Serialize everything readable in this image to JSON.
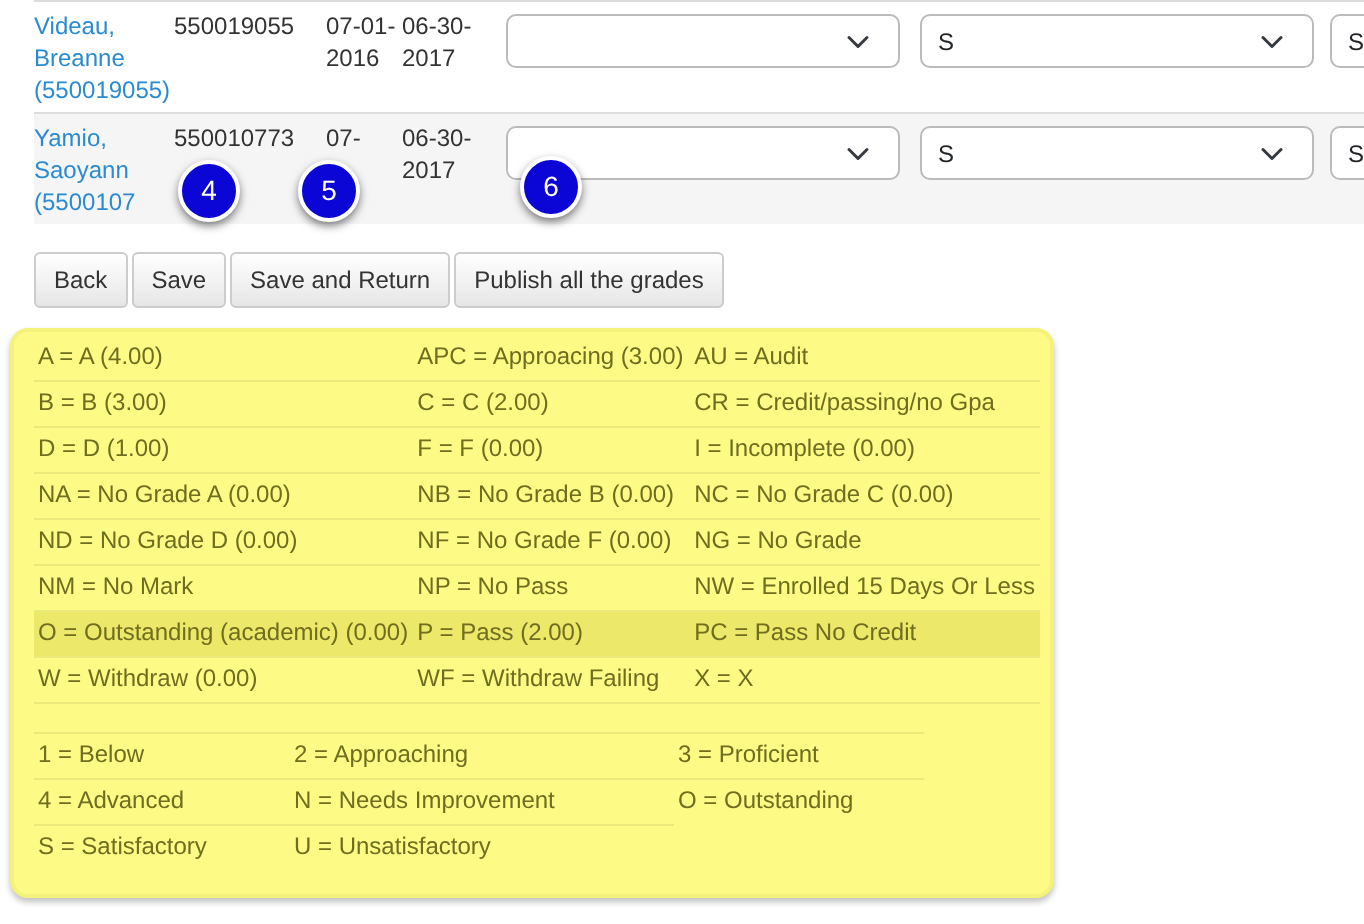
{
  "students": [
    {
      "name": "Videau, Breanne (550019055)",
      "id": "550019055",
      "start_date": "07-01-2016",
      "end_date": "06-30-2017",
      "selects": [
        {
          "kind": "select"
        },
        {
          "kind": "select",
          "value": "S"
        },
        {
          "kind": "select",
          "value": "S"
        }
      ]
    },
    {
      "name": "Yamio, Saoyann (5500107",
      "id": "550010773",
      "start_date": "07-",
      "end_date": "06-30-2017",
      "selects": [
        {
          "kind": "select"
        },
        {
          "kind": "select",
          "value": "S"
        },
        {
          "kind": "select",
          "value": "S"
        }
      ]
    }
  ],
  "callouts": [
    "4",
    "5",
    "6"
  ],
  "buttons": [
    "Back",
    "Save",
    "Save and Return",
    "Publish all the grades"
  ],
  "grade_codes": [
    {
      "cells": [
        "A = A (4.00)",
        "APC = Approacing (3.00)",
        "AU = Audit"
      ],
      "highlighted": false
    },
    {
      "cells": [
        "B = B (3.00)",
        "C = C (2.00)",
        "CR = Credit/passing/no Gpa"
      ],
      "highlighted": false
    },
    {
      "cells": [
        "D = D (1.00)",
        "F = F (0.00)",
        "I = Incomplete (0.00)"
      ],
      "highlighted": false
    },
    {
      "cells": [
        "NA = No Grade A (0.00)",
        "NB = No Grade B (0.00)",
        "NC = No Grade C (0.00)"
      ],
      "highlighted": false
    },
    {
      "cells": [
        "ND = No Grade D (0.00)",
        "NF = No Grade F (0.00)",
        "NG = No Grade"
      ],
      "highlighted": false
    },
    {
      "cells": [
        "NM = No Mark",
        "NP = No Pass",
        "NW = Enrolled 15 Days Or Less"
      ],
      "highlighted": false
    },
    {
      "cells": [
        "O = Outstanding (academic) (0.00)",
        "P = Pass (2.00)",
        "PC = Pass No Credit"
      ],
      "highlighted": true
    },
    {
      "cells": [
        "W = Withdraw (0.00)",
        "WF = Withdraw Failing",
        "X = X"
      ],
      "highlighted": false
    }
  ],
  "standard_codes": [
    {
      "cells": [
        "1 = Below",
        "2 = Approaching",
        "3 = Proficient"
      ]
    },
    {
      "cells": [
        "4 = Advanced",
        "N = Needs Improvement",
        "O = Outstanding"
      ]
    },
    {
      "cells": [
        "S = Satisfactory",
        "U = Unsatisfactory"
      ]
    }
  ]
}
